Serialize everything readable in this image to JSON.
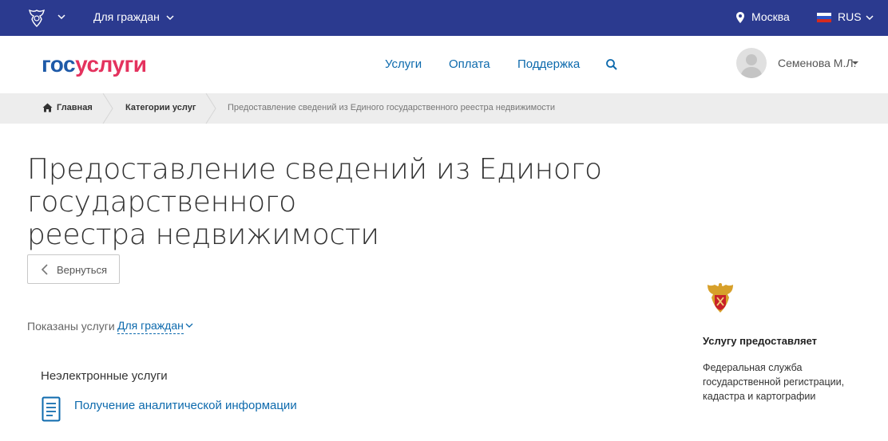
{
  "topbar": {
    "audience": "Для граждан",
    "city": "Москва",
    "language": "RUS"
  },
  "header": {
    "logo_part1": "гос",
    "logo_part2": "услуги",
    "nav": [
      "Услуги",
      "Оплата",
      "Поддержка"
    ],
    "user_name": "Семенова М.Л."
  },
  "breadcrumbs": {
    "home": "Главная",
    "categories": "Категории услуг",
    "current": "Предоставление сведений из Единого государственного реестра недвижимости"
  },
  "page": {
    "title_line1": "Предоставление сведений из Единого государственного",
    "title_line2": "реестра недвижимости",
    "back_label": "Вернуться",
    "filter_label": "Показаны услуги",
    "filter_value": "Для граждан",
    "section_heading": "Неэлектронные услуги",
    "service_link": "Получение аналитической информации"
  },
  "provider": {
    "heading": "Услугу предоставляет",
    "name": "Федеральная служба государственной регистрации, кадастра и картографии"
  },
  "colors": {
    "topbar": "#2b3a8f",
    "link": "#0d6aad",
    "logo_blue": "#1e5aa8",
    "logo_red": "#e4325e",
    "breadcrumb_bg": "#ededed"
  }
}
